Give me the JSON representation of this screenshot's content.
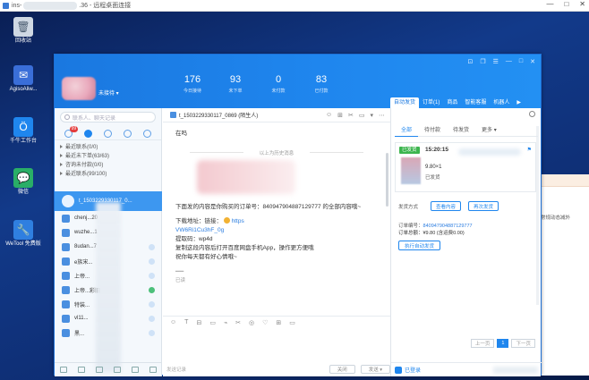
{
  "remote_desktop": {
    "title_prefix": "ins-",
    "title_suffix": ".36 - 远程桌面连接",
    "controls": {
      "minimize": "—",
      "maximize": "□",
      "close": "✕"
    }
  },
  "desktop_icons": [
    {
      "label": "回收站",
      "icon": "recycle-bin-icon",
      "glyph": "🗑"
    },
    {
      "label": "AgisoAliw...",
      "icon": "mail-icon",
      "glyph": "✉"
    },
    {
      "label": "千牛工作台",
      "icon": "qianniu-icon",
      "glyph": "Ö"
    },
    {
      "label": "微信",
      "icon": "wechat-icon",
      "glyph": "💬"
    },
    {
      "label": "WeTool 免费版",
      "icon": "wrench-icon",
      "glyph": "🔧"
    }
  ],
  "background_window_text": "常规动态减外",
  "app": {
    "nickname": "未接待 ▾",
    "stats": [
      {
        "value": "176",
        "label": "今日接待"
      },
      {
        "value": "93",
        "label": "未下单"
      },
      {
        "value": "0",
        "label": "未付款"
      },
      {
        "value": "83",
        "label": "已付款"
      }
    ],
    "top_controls": [
      "⊡",
      "❐",
      "☰",
      "—",
      "□",
      "✕"
    ],
    "right_tabs": [
      "自动发货",
      "订单(1)",
      "商品",
      "智能客服",
      "机器人",
      "▶"
    ]
  },
  "sidebar": {
    "search_placeholder": "联系人、聊天记录",
    "badge": "99",
    "groups": [
      "最近联系(0/0)",
      "最近未下单(63/63)",
      "咨询未付款(0/0)",
      "最近联系(99/100)"
    ],
    "selected_contact": "t_1503229330117_0...",
    "contacts": [
      {
        "name": "chenj...20",
        "dot": "none"
      },
      {
        "name": "wuzhe...1",
        "dot": "none"
      },
      {
        "name": "8udan...7",
        "dot": "blue"
      },
      {
        "name": "e族宋...",
        "dot": "blue"
      },
      {
        "name": "上帝...",
        "dot": "blue"
      },
      {
        "name": "上帝...彩旧",
        "dot": "green"
      },
      {
        "name": "特装...",
        "dot": "blue"
      },
      {
        "name": "vl11...",
        "dot": "blue"
      },
      {
        "name": "黑...",
        "dot": "blue"
      }
    ]
  },
  "chat": {
    "contact_title": "t_1503229330117_0869 (陌生人)",
    "tools": [
      "☺",
      "⊞",
      "✂",
      "▭",
      "▾",
      "⋯"
    ],
    "greeting": "在吗",
    "history_divider": "以上为历史消息",
    "message": {
      "line1": "下面发的内容是你购买的订单号：840947904887129777 的全部内容哦~",
      "download_label": "下载地址：链接：",
      "download_link": "https",
      "link_code": "VW6Ri1Cu3hF_0g",
      "extract_code": "提取码：wp4d",
      "copy_hint": "复制这段内容后打开百度网盘手机App，操作更方便哦",
      "wish": "祝你每天都有好心情哦~",
      "ellipsis": "──",
      "status": "已读"
    },
    "toolbar": [
      "☺",
      "T",
      "⊟",
      "▭",
      "⌁",
      "✂",
      "◎",
      "♡",
      "⊞",
      "▭"
    ],
    "input_hint": "发送记录",
    "close_label": "关闭",
    "send_label": "发送 ▾"
  },
  "panel": {
    "order_tabs": [
      "全部",
      "待付款",
      "待发货",
      "更多 ▾"
    ],
    "order": {
      "status": "已发货",
      "time": "15:20:15",
      "flag": "⚑",
      "price": "9.80×1",
      "shipped_label": "已发货"
    },
    "ship_method_label": "发货方式",
    "view_content_label": "查看内容",
    "resend_label": "再次发货",
    "order_number_label": "订单编号：",
    "order_number": "840947904887129777",
    "order_total": "订单总额：¥9.80 (含运费0.00)",
    "auto_button": "执行自动发货",
    "pager": {
      "prev": "上一页",
      "current": "1",
      "next": "下一页"
    },
    "logged_in": "已登录"
  }
}
